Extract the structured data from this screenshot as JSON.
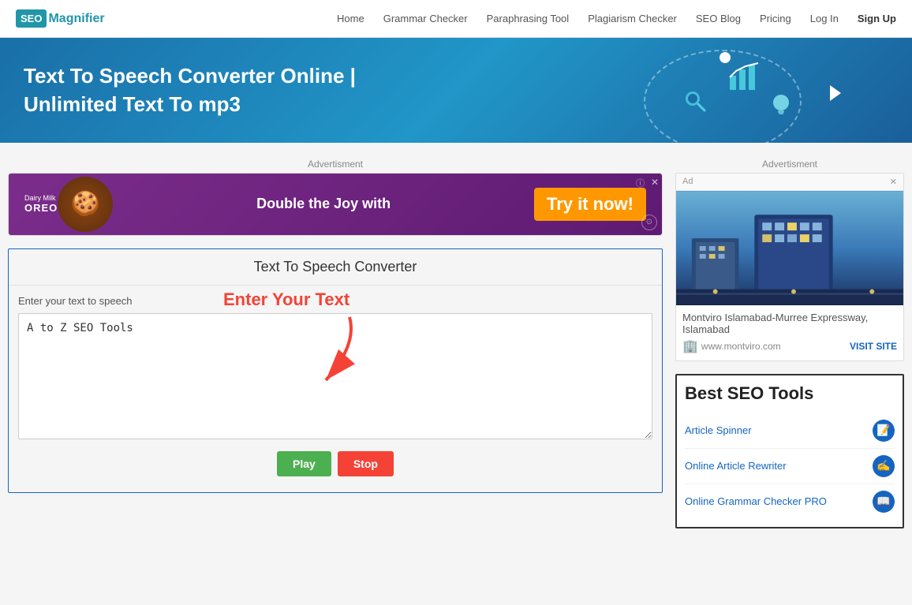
{
  "nav": {
    "logo_seo": "SEO",
    "logo_magnifier": "Magnifier",
    "links": [
      {
        "label": "Home",
        "href": "#"
      },
      {
        "label": "Grammar Checker",
        "href": "#"
      },
      {
        "label": "Paraphrasing Tool",
        "href": "#"
      },
      {
        "label": "Plagiarism Checker",
        "href": "#"
      },
      {
        "label": "SEO Blog",
        "href": "#"
      },
      {
        "label": "Pricing",
        "href": "#"
      },
      {
        "label": "Log In",
        "href": "#"
      },
      {
        "label": "Sign Up",
        "href": "#"
      }
    ]
  },
  "hero": {
    "title_line1": "Text To Speech Converter Online |",
    "title_line2": "Unlimited Text To mp3"
  },
  "content": {
    "ad_label": "Advertisment",
    "ad_brand": "Dairy Milk OREO",
    "ad_text": "Double the Joy with",
    "ad_cta": "Try it now!",
    "tool_title": "Text To Speech Converter",
    "input_label": "Enter your text to speech",
    "textarea_value": "A to Z SEO Tools",
    "enter_text_annotation": "Enter Your Text",
    "play_btn": "Play",
    "stop_btn": "Stop"
  },
  "sidebar": {
    "ad_label": "Advertisment",
    "ad_badge": "Ad",
    "ad_caption": "Montviro Islamabad-Murree Expressway, Islamabad",
    "ad_site": "www.montviro.com",
    "visit_site_label": "VISIT SITE",
    "seo_tools_title": "Best SEO Tools",
    "tools": [
      {
        "label": "Article Spinner",
        "icon": "📝"
      },
      {
        "label": "Online Article Rewriter",
        "icon": "✍️"
      },
      {
        "label": "Online Grammar Checker PRO",
        "icon": "📖"
      }
    ]
  }
}
